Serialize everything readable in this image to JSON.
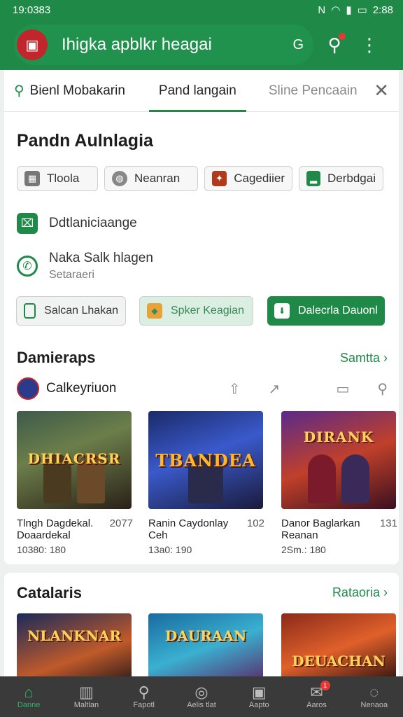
{
  "status": {
    "time": "19:0383",
    "right_time": "2:88",
    "icons": [
      "nfc-icon",
      "wifi-icon",
      "signal-icon",
      "battery-icon"
    ]
  },
  "appbar": {
    "title": "Ihigka apblkr heagai",
    "g_label": "G"
  },
  "tabs": [
    {
      "label": "Bienl Mobakarin"
    },
    {
      "label": "Pand langain"
    },
    {
      "label": "Sline Pencaain"
    }
  ],
  "section1": {
    "title": "Pandn Aulnlagia",
    "chips": [
      "Tloola",
      "Neanran",
      "Cagediier",
      "Derbdgai"
    ],
    "row1": {
      "title": "Ddtlaniciaange"
    },
    "row2": {
      "title": "Naka Salk hlagen",
      "subtitle": "Setaraeri"
    },
    "buttons": [
      "Salcan Lhakan",
      "Spker Keagian",
      "Dalecrla Dauonl"
    ]
  },
  "section2": {
    "title": "Damieraps",
    "link": "Samtta",
    "subtitle": "Calkeyriuon",
    "games": [
      {
        "art": "DHIACRSR",
        "title": "Tlngh Dagdekal.",
        "title2": "Doaardekal",
        "num": "2077",
        "meta": "10380: 180"
      },
      {
        "art": "TBANDEA",
        "title": "Ranin Caydonlay",
        "title2": "Ceh",
        "num": "102",
        "meta": "13a0: 190"
      },
      {
        "art": "DIRANK",
        "title": "Danor Baglarkan",
        "title2": "Reanan",
        "num": "131",
        "meta": "2Sm.: 180"
      }
    ]
  },
  "section3": {
    "title": "Catalaris",
    "link": "Rataoria",
    "arts": [
      "NLANKNAR",
      "DAURAAN",
      "DEUACHAN"
    ]
  },
  "bottomnav": [
    {
      "label": "Danne",
      "icon": "home-icon"
    },
    {
      "label": "Maltlan",
      "icon": "book-icon"
    },
    {
      "label": "Fapotl",
      "icon": "search-icon"
    },
    {
      "label": "Aelis tlat",
      "icon": "explore-icon"
    },
    {
      "label": "Aapto",
      "icon": "apps-icon"
    },
    {
      "label": "Aaros",
      "icon": "inbox-icon",
      "badge": "1"
    },
    {
      "label": "Nenaoa",
      "icon": "help-icon"
    }
  ],
  "colors": {
    "brand": "#1f8a47",
    "accent_red": "#c0262c",
    "nav_bg": "#3a3a3a"
  }
}
